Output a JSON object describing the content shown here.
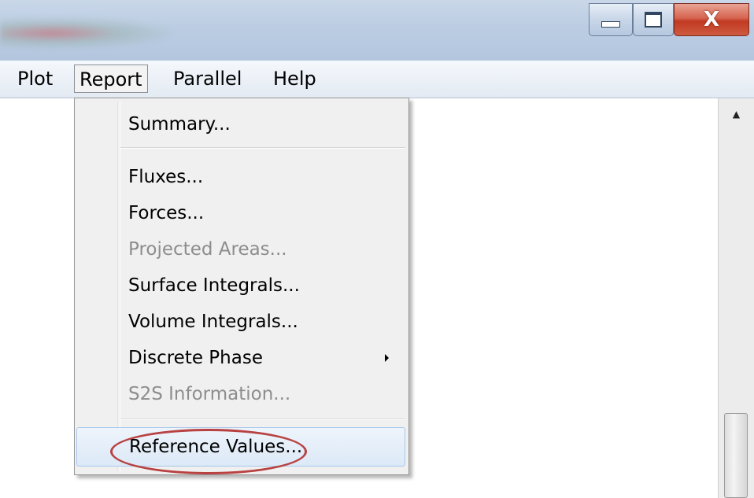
{
  "window": {
    "controls": {
      "minimize_icon": "minimize-icon",
      "maximize_icon": "maximize-icon",
      "close_icon": "close-icon",
      "close_glyph": "X"
    }
  },
  "menubar": {
    "items": [
      {
        "label": "Plot"
      },
      {
        "label": "Report"
      },
      {
        "label": "Parallel"
      },
      {
        "label": "Help"
      }
    ],
    "active": "Report"
  },
  "report_menu": {
    "items": [
      {
        "label": "Summary...",
        "enabled": true
      },
      {
        "label": "Fluxes...",
        "enabled": true
      },
      {
        "label": "Forces...",
        "enabled": true
      },
      {
        "label": "Projected Areas...",
        "enabled": false
      },
      {
        "label": "Surface Integrals...",
        "enabled": true
      },
      {
        "label": "Volume Integrals...",
        "enabled": true
      },
      {
        "label": "Discrete Phase",
        "enabled": true,
        "submenu": true
      },
      {
        "label": "S2S Information...",
        "enabled": false
      },
      {
        "label": "Reference Values...",
        "enabled": true,
        "highlighted": true
      }
    ]
  },
  "colors": {
    "annotation": "#b84242",
    "highlight_border": "#a8c7ea",
    "close_button": "#c23a22"
  }
}
